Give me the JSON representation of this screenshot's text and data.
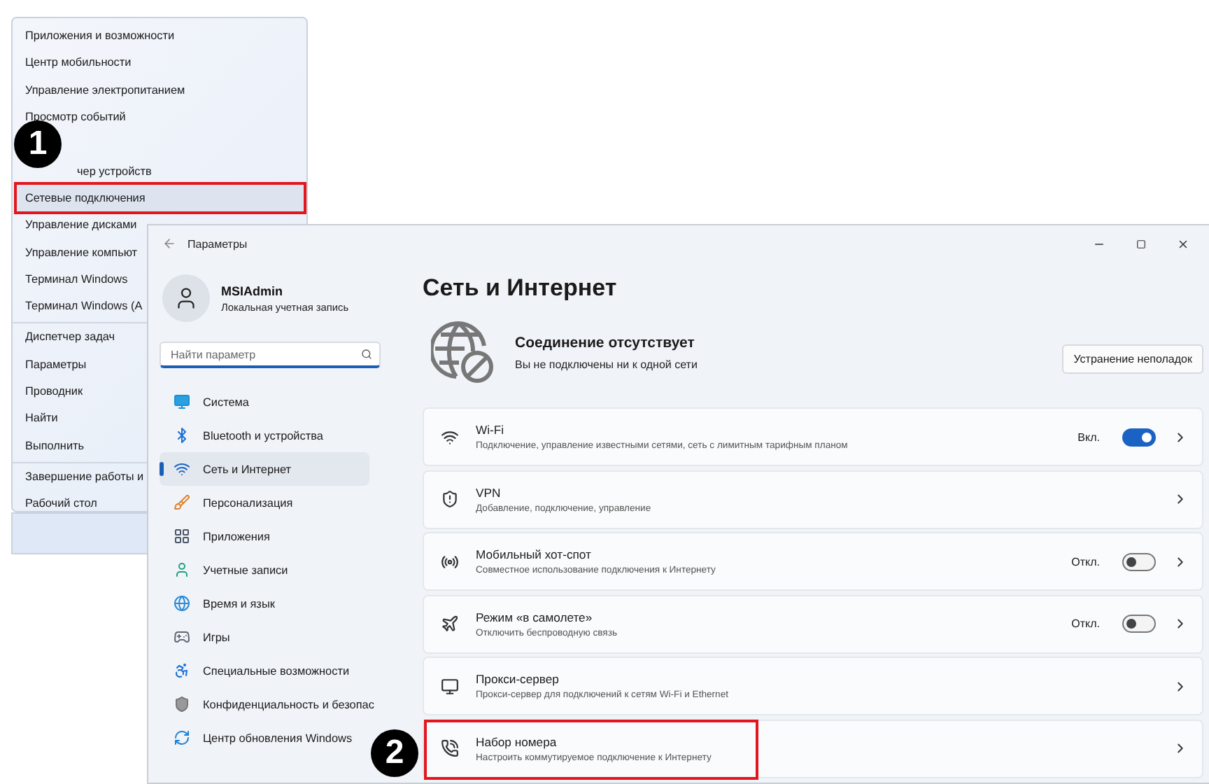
{
  "context_menu": {
    "groups": [
      {
        "items": [
          {
            "label": "Приложения и возможности",
            "highlighted": false
          },
          {
            "label": "Центр мобильности",
            "highlighted": false
          },
          {
            "label": "Управление электропитанием",
            "highlighted": false
          },
          {
            "label": "Просмотр событий",
            "highlighted": false
          },
          {
            "label": "чер устройств",
            "highlighted": false,
            "kind": "partly_covered"
          },
          {
            "label": "Сетевые подключения",
            "highlighted": true
          },
          {
            "label": "Управление дисками",
            "highlighted": false
          },
          {
            "label": "Управление компьют",
            "highlighted": false
          },
          {
            "label": "Терминал Windows",
            "highlighted": false
          },
          {
            "label": "Терминал Windows (А",
            "highlighted": false
          }
        ]
      },
      {
        "items": [
          {
            "label": "Диспетчер задач",
            "highlighted": false
          },
          {
            "label": "Параметры",
            "highlighted": false
          },
          {
            "label": "Проводник",
            "highlighted": false
          },
          {
            "label": "Найти",
            "highlighted": false
          },
          {
            "label": "Выполнить",
            "highlighted": false
          }
        ]
      },
      {
        "items": [
          {
            "label": "Завершение работы и",
            "highlighted": false
          },
          {
            "label": "Рабочий стол",
            "highlighted": false
          }
        ]
      }
    ]
  },
  "step_badges": [
    "1",
    "2"
  ],
  "settings_window": {
    "title": "Параметры",
    "account": {
      "name": "MSIAdmin",
      "subtitle": "Локальная учетная запись"
    },
    "search": {
      "placeholder": "Найти параметр"
    },
    "nav": [
      {
        "label": "Система",
        "selected": false
      },
      {
        "label": "Bluetooth и устройства",
        "selected": false
      },
      {
        "label": "Сеть и Интернет",
        "selected": true
      },
      {
        "label": "Персонализация",
        "selected": false
      },
      {
        "label": "Приложения",
        "selected": false
      },
      {
        "label": "Учетные записи",
        "selected": false
      },
      {
        "label": "Время и язык",
        "selected": false
      },
      {
        "label": "Игры",
        "selected": false
      },
      {
        "label": "Специальные возможности",
        "selected": false
      },
      {
        "label": "Конфиденциальность и безопас",
        "selected": false
      },
      {
        "label": "Центр обновления Windows",
        "selected": false
      }
    ],
    "page_title": "Сеть и Интернет",
    "status": {
      "title": "Соединение отсутствует",
      "subtitle": "Вы не подключены ни к одной сети",
      "button": "Устранение неполадок"
    },
    "cards": [
      {
        "kind": "toggle",
        "title": "Wi-Fi",
        "subtitle": "Подключение, управление известными сетями, сеть с лимитным тарифным планом",
        "state_label": "Вкл.",
        "on": true,
        "highlighted": false
      },
      {
        "kind": "link",
        "title": "VPN",
        "subtitle": "Добавление, подключение, управление",
        "highlighted": false
      },
      {
        "kind": "toggle",
        "title": "Мобильный хот-спот",
        "subtitle": "Совместное использование подключения к Интернету",
        "state_label": "Откл.",
        "on": false,
        "highlighted": false
      },
      {
        "kind": "toggle",
        "title": "Режим «в самолете»",
        "subtitle": "Отключить беспроводную связь",
        "state_label": "Откл.",
        "on": false,
        "highlighted": false
      },
      {
        "kind": "link",
        "title": "Прокси-сервер",
        "subtitle": "Прокси-сервер для подключений к сетям Wi-Fi и Ethernet",
        "highlighted": false
      },
      {
        "kind": "link",
        "title": "Набор номера",
        "subtitle": "Настроить коммутируемое подключение к Интернету",
        "highlighted": true
      }
    ]
  }
}
